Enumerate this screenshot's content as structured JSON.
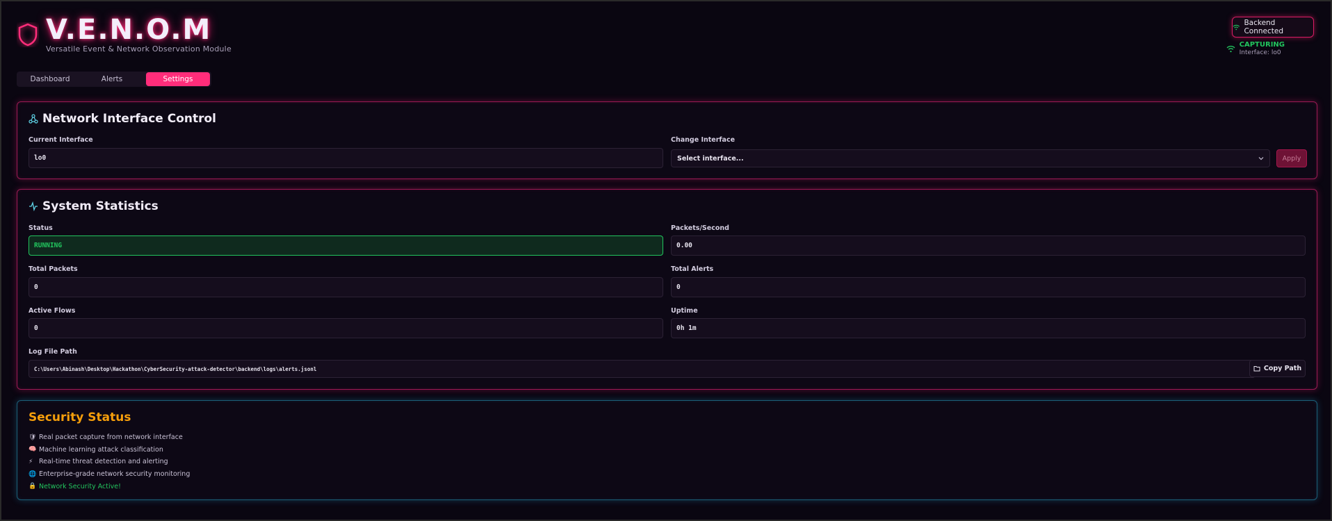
{
  "brand": {
    "title": "V.E.N.O.M",
    "subtitle": "Versatile Event & Network Observation Module",
    "accent": "#ff2d7a"
  },
  "connection": {
    "badge_label": "Backend Connected",
    "capture_status": "CAPTURING",
    "capture_interface": "Interface: lo0"
  },
  "tabs": [
    {
      "label": "Dashboard",
      "active": false
    },
    {
      "label": "Alerts",
      "active": false
    },
    {
      "label": "Settings",
      "active": true
    }
  ],
  "network_panel": {
    "title": "Network Interface Control",
    "current_label": "Current Interface",
    "current_value": "lo0",
    "change_label": "Change Interface",
    "select_placeholder": "Select interface...",
    "apply_label": "Apply"
  },
  "stats_panel": {
    "title": "System Statistics",
    "status_label": "Status",
    "status_value": "RUNNING",
    "pps_label": "Packets/Second",
    "pps_value": "0.00",
    "total_packets_label": "Total Packets",
    "total_packets_value": "0",
    "total_alerts_label": "Total Alerts",
    "total_alerts_value": "0",
    "active_flows_label": "Active Flows",
    "active_flows_value": "0",
    "uptime_label": "Uptime",
    "uptime_value": "0h 1m",
    "log_path_label": "Log File Path",
    "log_path_value": "C:\\Users\\Abinash\\Desktop\\Hackathon\\CyberSecurity-attack-detector\\backend\\logs\\alerts.jsonl",
    "copy_label": "Copy Path"
  },
  "security_panel": {
    "title": "Security Status",
    "items": [
      {
        "icon": "shield-icon",
        "glyph": "🛡",
        "text": "Real packet capture from network interface"
      },
      {
        "icon": "brain-icon",
        "glyph": "🧠",
        "text": "Machine learning attack classification"
      },
      {
        "icon": "lightning-icon",
        "glyph": "⚡",
        "text": "Real-time threat detection and alerting"
      },
      {
        "icon": "globe-icon",
        "glyph": "🌐",
        "text": "Enterprise-grade network security monitoring"
      },
      {
        "icon": "lock-icon",
        "glyph": "🔒",
        "text": "Network Security Active!"
      }
    ]
  }
}
